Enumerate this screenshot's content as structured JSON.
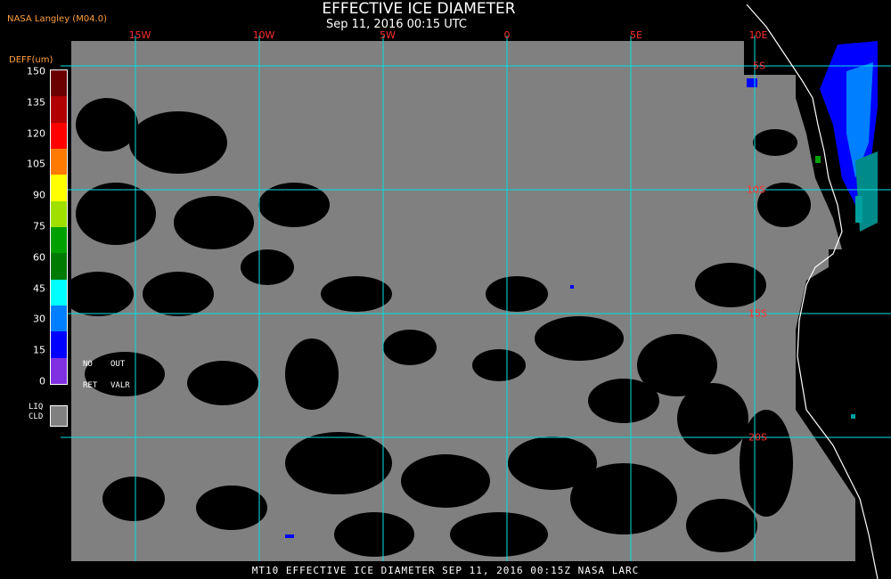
{
  "header": {
    "title": "EFFECTIVE ICE DIAMETER",
    "subtitle": "Sep 11, 2016 00:15 UTC",
    "source": "NASA Langley (M04.0)"
  },
  "footer": {
    "text": "MT10  EFFECTIVE ICE DIAMETER   SEP 11, 2016 00:15Z   NASA LARC"
  },
  "legend": {
    "units": "DEFF(um)",
    "ticks": [
      "150",
      "135",
      "120",
      "105",
      "90",
      "75",
      "60",
      "45",
      "30",
      "15",
      "0"
    ],
    "colors": [
      "#6a0000",
      "#b00000",
      "#ff0000",
      "#ff7a00",
      "#ffff00",
      "#a0e000",
      "#00a000",
      "#007a00",
      "#00ffff",
      "#0080ff",
      "#0000ff",
      "#8030e0"
    ],
    "no_ret": [
      "NO",
      "RET"
    ],
    "out_valr": [
      "OUT",
      "VALR"
    ],
    "liquid_cloud": [
      "LIQ",
      "CLD"
    ],
    "liquid_cloud_color": "#808080"
  },
  "map": {
    "background_color": "#000000",
    "cloud_color": "#808080",
    "grid_color": "#00e0e0",
    "coast_color": "#ffffff",
    "lon_labels": [
      "15W",
      "10W",
      "5W",
      "0",
      "5E",
      "10E"
    ],
    "lat_labels": [
      "5S",
      "10S",
      "15S",
      "20S"
    ]
  }
}
